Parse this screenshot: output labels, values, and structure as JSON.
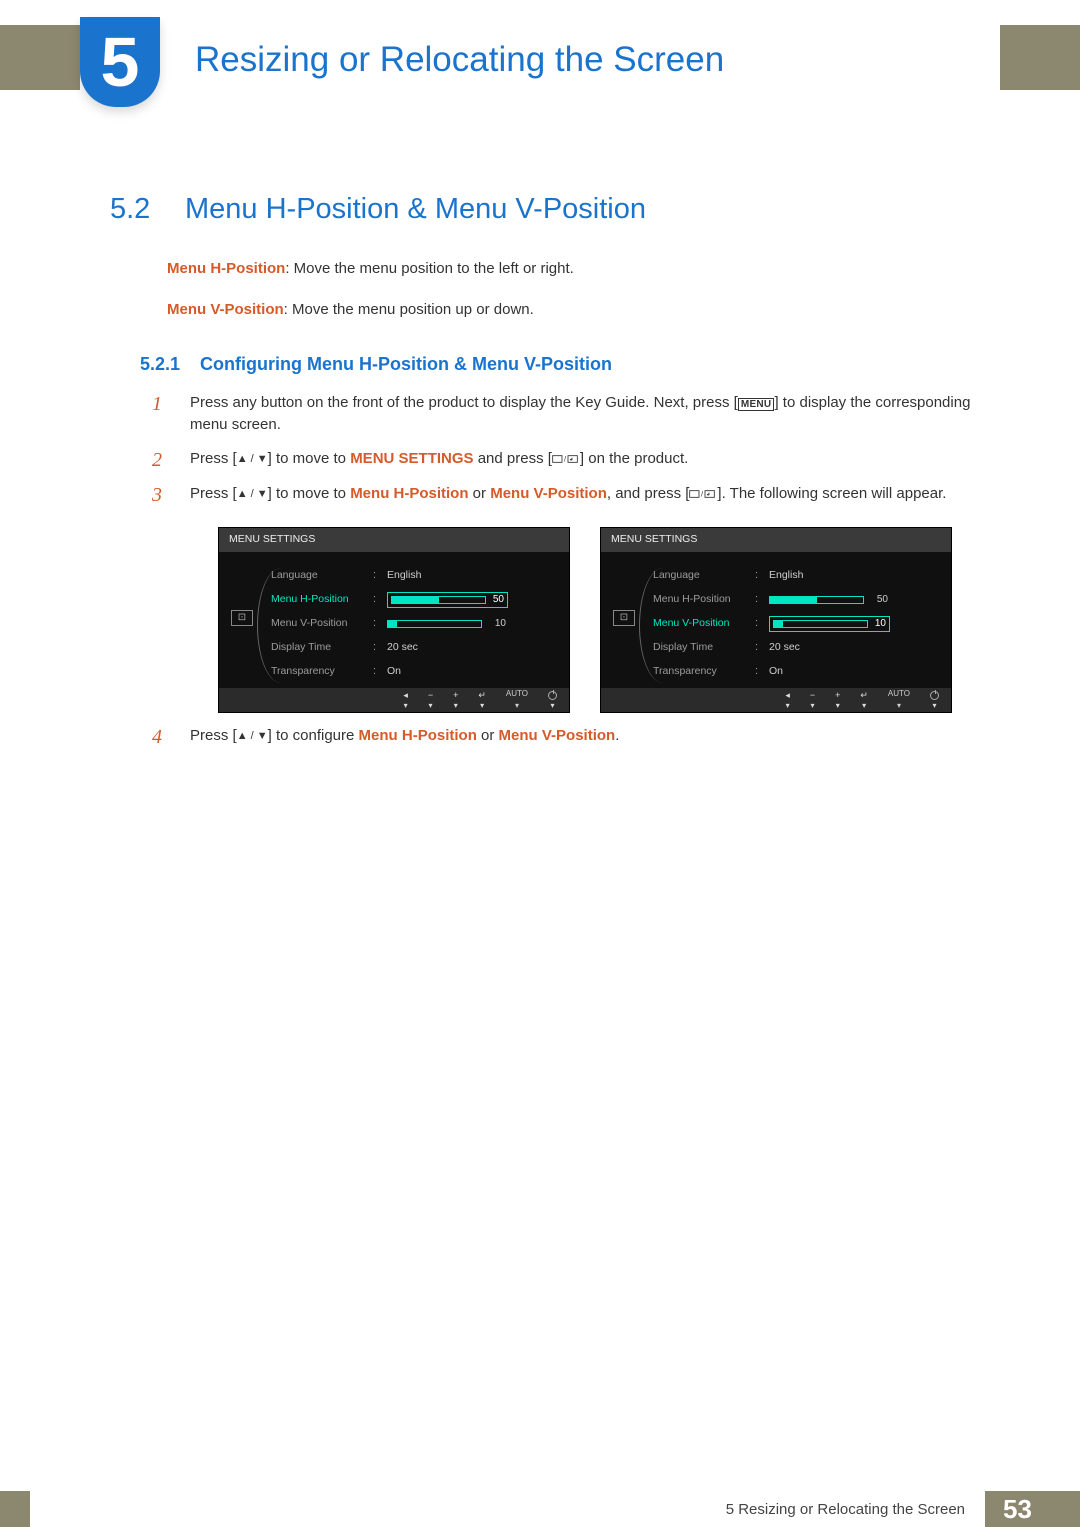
{
  "chapter": {
    "number": "5",
    "title": "Resizing or Relocating the Screen"
  },
  "section": {
    "number": "5.2",
    "title": "Menu H-Position & Menu V-Position"
  },
  "intro": {
    "hpos_label": "Menu H-Position",
    "hpos_desc": ": Move the menu position to the left or right.",
    "vpos_label": "Menu V-Position",
    "vpos_desc": ": Move the menu position up or down."
  },
  "subsection": {
    "number": "5.2.1",
    "title": "Configuring Menu H-Position & Menu V-Position"
  },
  "steps": {
    "s1": {
      "num": "1",
      "a": "Press any button on the front of the product to display the Key Guide. Next, press [",
      "menu_key": "MENU",
      "b": "] to display the corresponding menu screen."
    },
    "s2": {
      "num": "2",
      "a": "Press [",
      "b": "] to move to ",
      "target": "MENU SETTINGS",
      "c": " and press [",
      "d": "] on the product."
    },
    "s3": {
      "num": "3",
      "a": "Press [",
      "b": "] to move to ",
      "t1": "Menu H-Position",
      "mid": " or ",
      "t2": "Menu V-Position",
      "c": ", and press [",
      "d": "]. The following screen will appear."
    },
    "s4": {
      "num": "4",
      "a": "Press [",
      "b": "] to configure ",
      "t1": "Menu H-Position",
      "mid": " or ",
      "t2": "Menu V-Position",
      "end": "."
    }
  },
  "osd": {
    "title": "MENU SETTINGS",
    "rows": {
      "language": {
        "label": "Language",
        "value": "English"
      },
      "hpos": {
        "label": "Menu H-Position",
        "value": "50"
      },
      "vpos": {
        "label": "Menu V-Position",
        "value": "10"
      },
      "dtime": {
        "label": "Display Time",
        "value": "20 sec"
      },
      "trans": {
        "label": "Transparency",
        "value": "On"
      }
    },
    "footer": {
      "auto": "AUTO"
    }
  },
  "footer": {
    "text": "5 Resizing or Relocating the Screen",
    "page": "53"
  }
}
